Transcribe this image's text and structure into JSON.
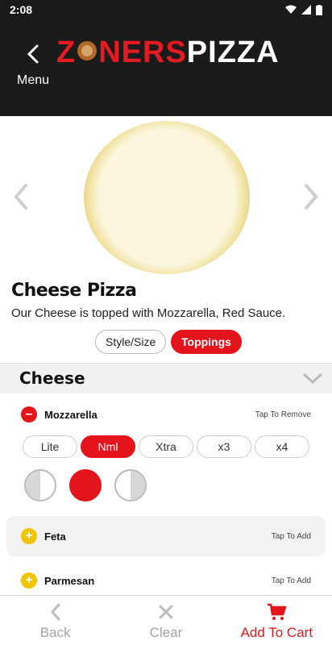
{
  "status_bar": {
    "time": "2:08"
  },
  "header": {
    "back_label": "Menu",
    "logo_part1": "Z",
    "logo_part2": "NERS",
    "logo_part3": "PIZZA"
  },
  "item": {
    "title": "Cheese Pizza",
    "description": "Our Cheese  is topped with Mozzarella, Red Sauce."
  },
  "tabs": {
    "style_size": "Style/Size",
    "toppings": "Toppings"
  },
  "section": {
    "title": "Cheese"
  },
  "toppings": [
    {
      "name": "Mozzarella",
      "action": "Tap To Remove"
    },
    {
      "name": "Feta",
      "action": "Tap To Add"
    },
    {
      "name": "Parmesan",
      "action": "Tap To Add"
    }
  ],
  "amounts": [
    "Lite",
    "Nml",
    "Xtra",
    "x3",
    "x4"
  ],
  "bottom_bar": {
    "back": "Back",
    "clear": "Clear",
    "add_to_cart": "Add To Cart"
  },
  "colors": {
    "accent": "#e3141c",
    "header_bg": "#1b1b1b",
    "plus": "#f2c400"
  }
}
